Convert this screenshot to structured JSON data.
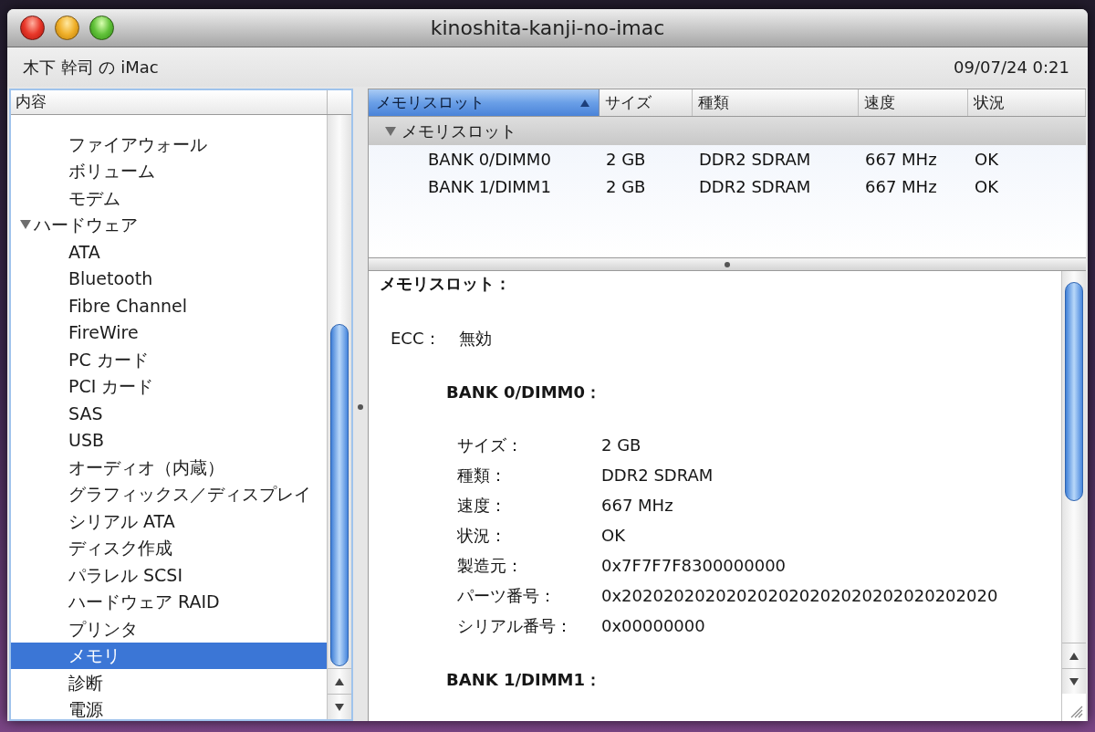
{
  "window": {
    "title": "kinoshita-kanji-no-imac"
  },
  "toolbar": {
    "computer_name": "木下 幹司 の iMac",
    "date_time": "09/07/24 0:21"
  },
  "sidebar": {
    "header": "内容",
    "tree": [
      {
        "children": [
          {
            "label": "ファイアウォール",
            "selected": false
          },
          {
            "label": "ボリューム",
            "selected": false
          },
          {
            "label": "モデム",
            "selected": false
          }
        ]
      },
      {
        "label": "ハードウェア",
        "expanded": true,
        "selected": false,
        "children": [
          {
            "label": "ATA",
            "selected": false
          },
          {
            "label": "Bluetooth",
            "selected": false
          },
          {
            "label": "Fibre Channel",
            "selected": false
          },
          {
            "label": "FireWire",
            "selected": false
          },
          {
            "label": "PC カード",
            "selected": false
          },
          {
            "label": "PCI カード",
            "selected": false
          },
          {
            "label": "SAS",
            "selected": false
          },
          {
            "label": "USB",
            "selected": false
          },
          {
            "label": "オーディオ（内蔵）",
            "selected": false
          },
          {
            "label": "グラフィックス／ディスプレイ",
            "selected": false
          },
          {
            "label": "シリアル ATA",
            "selected": false
          },
          {
            "label": "ディスク作成",
            "selected": false
          },
          {
            "label": "パラレル SCSI",
            "selected": false
          },
          {
            "label": "ハードウェア RAID",
            "selected": false
          },
          {
            "label": "プリンタ",
            "selected": false
          },
          {
            "label": "メモリ",
            "selected": true
          },
          {
            "label": "診断",
            "selected": false
          },
          {
            "label": "電源",
            "selected": false
          }
        ]
      }
    ]
  },
  "table": {
    "columns": [
      {
        "label": "メモリスロット",
        "sorted": true
      },
      {
        "label": "サイズ",
        "sorted": false
      },
      {
        "label": "種類",
        "sorted": false
      },
      {
        "label": "速度",
        "sorted": false
      },
      {
        "label": "状況",
        "sorted": false
      }
    ],
    "groups": [
      {
        "label": "メモリスロット",
        "expanded": true,
        "rows": [
          [
            "BANK 0/DIMM0",
            "2 GB",
            "DDR2 SDRAM",
            "667 MHz",
            "OK"
          ],
          [
            "BANK 1/DIMM1",
            "2 GB",
            "DDR2 SDRAM",
            "667 MHz",
            "OK"
          ]
        ]
      }
    ]
  },
  "detail": {
    "title": "メモリスロット：",
    "fields": [
      {
        "label": "ECC：",
        "value": "無効"
      }
    ],
    "sections": [
      {
        "title": "BANK 0/DIMM0：",
        "fields": [
          {
            "label": "サイズ：",
            "value": "2 GB"
          },
          {
            "label": "種類：",
            "value": "DDR2 SDRAM"
          },
          {
            "label": "速度：",
            "value": "667 MHz"
          },
          {
            "label": "状況：",
            "value": "OK"
          },
          {
            "label": "製造元：",
            "value": "0x7F7F7F8300000000"
          },
          {
            "label": "パーツ番号：",
            "value": "0x202020202020202020202020202020202020"
          },
          {
            "label": "シリアル番号：",
            "value": "0x00000000"
          }
        ]
      },
      {
        "title": "BANK 1/DIMM1："
      }
    ]
  }
}
